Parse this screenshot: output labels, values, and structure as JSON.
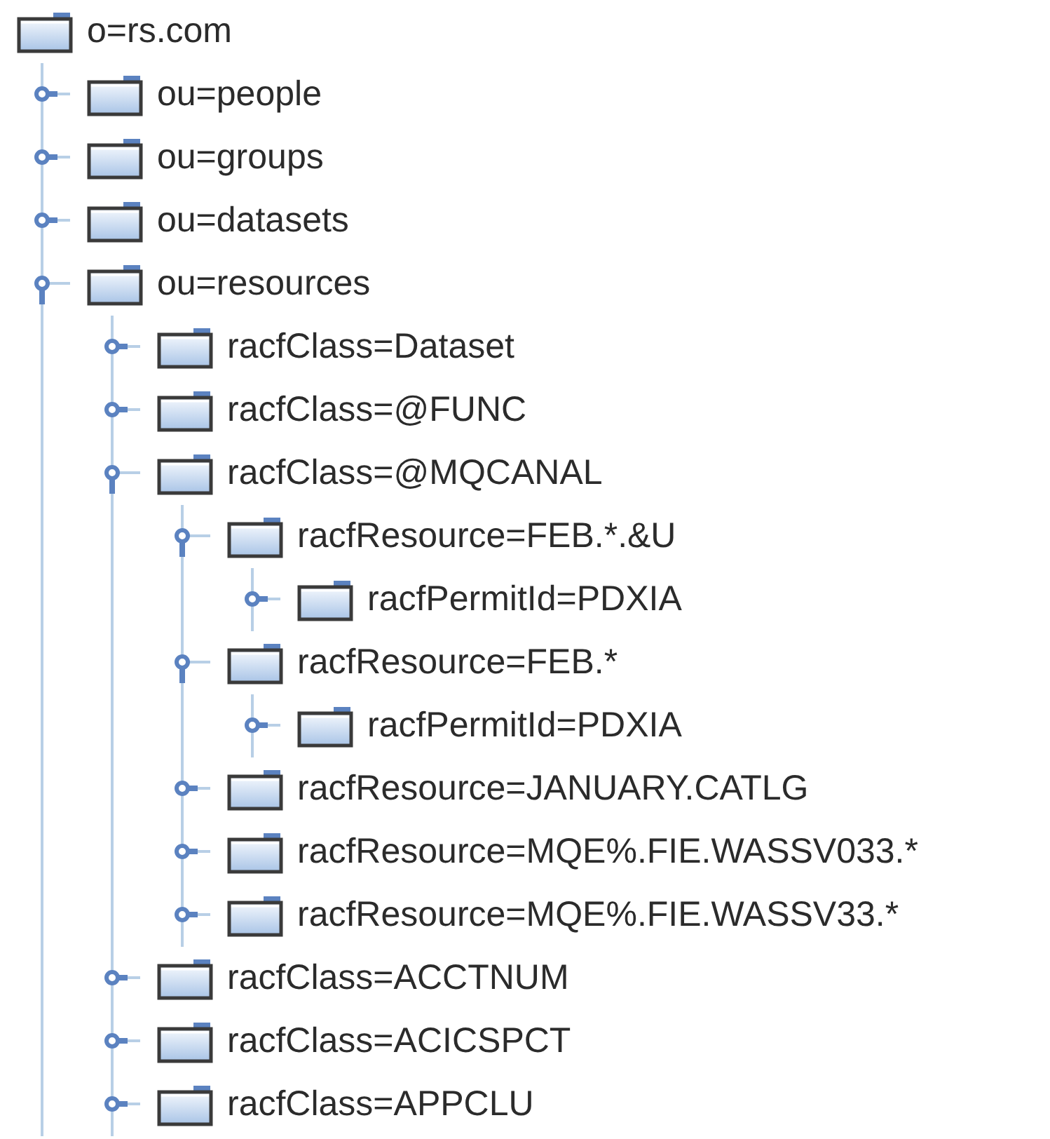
{
  "tree": {
    "label": "o=rs.com",
    "children": [
      {
        "label": "ou=people",
        "expanded": false
      },
      {
        "label": "ou=groups",
        "expanded": false
      },
      {
        "label": "ou=datasets",
        "expanded": false
      },
      {
        "label": "ou=resources",
        "expanded": true,
        "children": [
          {
            "label": "racfClass=Dataset",
            "expanded": false
          },
          {
            "label": "racfClass=@FUNC",
            "expanded": false
          },
          {
            "label": "racfClass=@MQCANAL",
            "expanded": true,
            "children": [
              {
                "label": "racfResource=FEB.*.&U",
                "expanded": true,
                "children": [
                  {
                    "label": "racfPermitId=PDXIA",
                    "expanded": false
                  }
                ]
              },
              {
                "label": "racfResource=FEB.*",
                "expanded": true,
                "children": [
                  {
                    "label": "racfPermitId=PDXIA",
                    "expanded": false
                  }
                ]
              },
              {
                "label": "racfResource=JANUARY.CATLG",
                "expanded": false
              },
              {
                "label": "racfResource=MQE%.FIE.WASSV033.*",
                "expanded": false
              },
              {
                "label": "racfResource=MQE%.FIE.WASSV33.*",
                "expanded": false
              }
            ]
          },
          {
            "label": "racfClass=ACCTNUM",
            "expanded": false
          },
          {
            "label": "racfClass=ACICSPCT",
            "expanded": false
          },
          {
            "label": "racfClass=APPCLU",
            "expanded": false
          }
        ]
      }
    ]
  }
}
